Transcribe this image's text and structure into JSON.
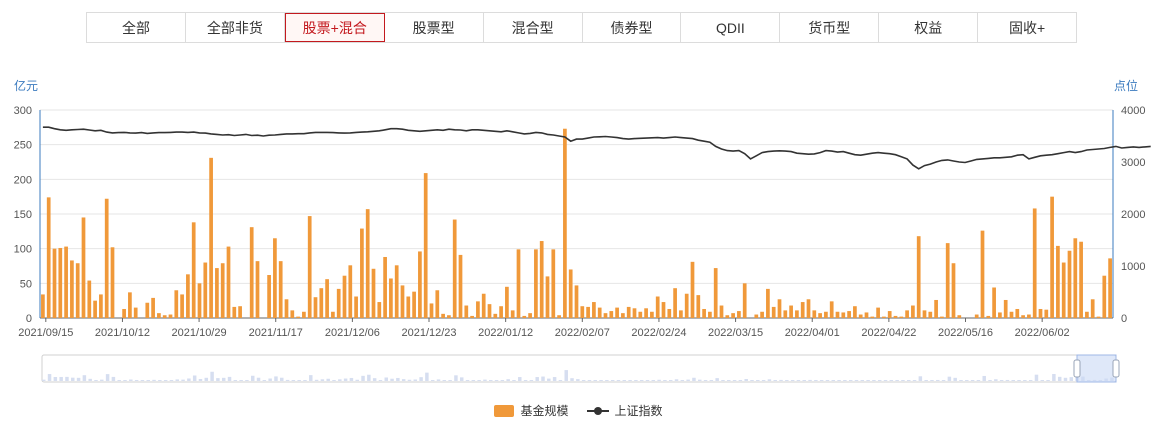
{
  "tabs": [
    {
      "label": "全部"
    },
    {
      "label": "全部非货"
    },
    {
      "label": "股票+混合",
      "active": true
    },
    {
      "label": "股票型"
    },
    {
      "label": "混合型"
    },
    {
      "label": "债券型"
    },
    {
      "label": "QDII"
    },
    {
      "label": "货币型"
    },
    {
      "label": "权益"
    },
    {
      "label": "固收+"
    }
  ],
  "colors": {
    "bar": "#f0993a",
    "line": "#333333",
    "axis": "#3b7bbf",
    "grid": "#e6e6e6",
    "zoom": "#c9d9f5"
  },
  "legend": {
    "bar_label": "基金规模",
    "line_label": "上证指数"
  },
  "chart_data": {
    "type": "bar+line",
    "y_left": {
      "label": "亿元",
      "min": 0,
      "max": 300,
      "ticks": [
        0,
        50,
        100,
        150,
        200,
        250,
        300
      ]
    },
    "y_right": {
      "label": "点位",
      "min": 0,
      "max": 4000,
      "ticks": [
        0,
        1000,
        2000,
        3000,
        4000
      ]
    },
    "x_ticks": [
      "2021/09/15",
      "2021/10/12",
      "2021/10/29",
      "2021/11/17",
      "2021/12/06",
      "2021/12/23",
      "2022/01/12",
      "2022/02/07",
      "2022/02/24",
      "2022/03/15",
      "2022/04/01",
      "2022/04/22",
      "2022/05/16",
      "2022/06/02"
    ],
    "grid": true,
    "series": [
      {
        "name": "基金规模",
        "type": "bar",
        "values": [
          34,
          174,
          100,
          101,
          103,
          83,
          79,
          145,
          54,
          25,
          34,
          172,
          102,
          0,
          13,
          37,
          15,
          0,
          22,
          29,
          7,
          4,
          5,
          40,
          34,
          63,
          138,
          50,
          80,
          231,
          72,
          79,
          103,
          16,
          17,
          0,
          131,
          82,
          0,
          62,
          115,
          82,
          27,
          11,
          2,
          9,
          147,
          30,
          43,
          56,
          9,
          42,
          61,
          76,
          31,
          129,
          157,
          71,
          23,
          88,
          57,
          76,
          47,
          31,
          38,
          96,
          209,
          21,
          40,
          6,
          4,
          142,
          91,
          18,
          3,
          24,
          35,
          20,
          6,
          17,
          45,
          11,
          99,
          3,
          7,
          99,
          111,
          60,
          99,
          4,
          273,
          70,
          47,
          17,
          16,
          23,
          15,
          7,
          10,
          15,
          7,
          16,
          14,
          9,
          14,
          9,
          31,
          23,
          13,
          43,
          11,
          35,
          81,
          33,
          13,
          9,
          72,
          18,
          4,
          7,
          10,
          50,
          0,
          5,
          9,
          42,
          16,
          27,
          11,
          18,
          11,
          23,
          27,
          11,
          7,
          9,
          24,
          9,
          8,
          10,
          17,
          5,
          8,
          2,
          15,
          2,
          10,
          3,
          2,
          11,
          18,
          118,
          11,
          9,
          26,
          2,
          108,
          79,
          4,
          0,
          0,
          5,
          126,
          3,
          44,
          8,
          26,
          9,
          13,
          4,
          5,
          158,
          13,
          12,
          175,
          104,
          80,
          97,
          115,
          110,
          9,
          27,
          2,
          61,
          86
        ]
      },
      {
        "name": "上证指数",
        "type": "line",
        "values": [
          3670,
          3670,
          3640,
          3620,
          3610,
          3620,
          3625,
          3630,
          3615,
          3600,
          3610,
          3575,
          3560,
          3565,
          3570,
          3560,
          3555,
          3565,
          3550,
          3560,
          3565,
          3565,
          3570,
          3575,
          3575,
          3570,
          3575,
          3560,
          3555,
          3540,
          3530,
          3520,
          3525,
          3510,
          3520,
          3530,
          3510,
          3515,
          3500,
          3515,
          3520,
          3530,
          3540,
          3540,
          3545,
          3545,
          3560,
          3570,
          3570,
          3570,
          3565,
          3560,
          3555,
          3560,
          3570,
          3575,
          3580,
          3590,
          3600,
          3620,
          3640,
          3640,
          3630,
          3610,
          3600,
          3590,
          3600,
          3610,
          3620,
          3610,
          3630,
          3620,
          3615,
          3600,
          3620,
          3620,
          3610,
          3600,
          3590,
          3580,
          3600,
          3580,
          3560,
          3540,
          3550,
          3570,
          3560,
          3530,
          3520,
          3500,
          3480,
          3400,
          3440,
          3440,
          3460,
          3480,
          3485,
          3490,
          3480,
          3470,
          3450,
          3440,
          3450,
          3455,
          3460,
          3465,
          3470,
          3460,
          3470,
          3480,
          3470,
          3460,
          3450,
          3420,
          3400,
          3380,
          3300,
          3250,
          3220,
          3210,
          3220,
          3160,
          3060,
          3120,
          3180,
          3200,
          3210,
          3215,
          3210,
          3200,
          3170,
          3160,
          3150,
          3155,
          3180,
          3220,
          3210,
          3190,
          3200,
          3170,
          3140,
          3130,
          3150,
          3170,
          3180,
          3170,
          3160,
          3140,
          3100,
          3060,
          2940,
          2870,
          2930,
          2960,
          3000,
          3030,
          3040,
          3020,
          3000,
          2990,
          3020,
          3050,
          3060,
          3070,
          3080,
          3080,
          3090,
          3100,
          3130,
          3140,
          3060,
          3090,
          3120,
          3130,
          3140,
          3160,
          3180,
          3200,
          3180,
          3200,
          3230,
          3240,
          3250,
          3260,
          3280,
          3300,
          3270,
          3280,
          3290,
          3280,
          3290,
          3300
        ]
      }
    ]
  }
}
